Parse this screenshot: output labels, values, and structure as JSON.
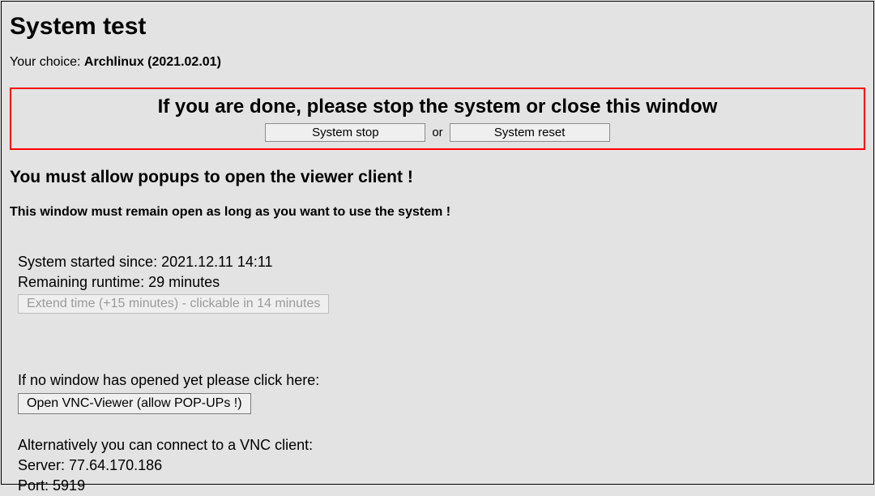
{
  "title": "System test",
  "choice": {
    "label": "Your choice:",
    "value": "Archlinux (2021.02.01)"
  },
  "warn": {
    "heading": "If you are done, please stop the system or close this window",
    "stop_label": "System stop",
    "or_label": "or",
    "reset_label": "System reset"
  },
  "popup_heading": "You must allow popups to open the viewer client !",
  "remain_open_note": "This window must remain open as long as you want to use the system !",
  "status": {
    "started_label": "System started since:",
    "started_value": "2021.12.11 14:11",
    "remaining_label": "Remaining runtime:",
    "remaining_value": "29 minutes",
    "extend_button": "Extend time (+15 minutes) - clickable in 14 minutes"
  },
  "vnc": {
    "no_window_line": "If no window has opened yet please click here:",
    "open_button": "Open VNC-Viewer (allow POP-UPs !)",
    "alt_line": "Alternatively you can connect to a VNC client:",
    "server_label": "Server:",
    "server_value": "77.64.170.186",
    "port_label": "Port:",
    "port_value": "5919"
  }
}
